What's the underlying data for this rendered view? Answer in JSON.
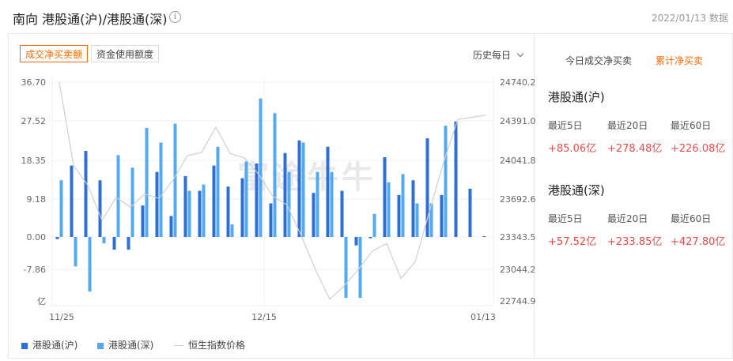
{
  "header": {
    "title": "南向 港股通(沪)/港股通(深)",
    "info_icon": "info-icon",
    "date": "2022/01/13 数据"
  },
  "tabs": {
    "net_buy": "成交净买卖额",
    "fund_usage": "资金使用额度"
  },
  "period_select": "历史每日",
  "watermark": "富途牛牛",
  "colors": {
    "hk_sh": "#2a6fdb",
    "hk_sz": "#55a9f0",
    "hsi": "#cfcfcf",
    "accent": "#ff6a00",
    "positive": "#f04848"
  },
  "chart_data": {
    "type": "bar",
    "left_axis_ticks": [
      "36.70",
      "27.52",
      "18.35",
      "9.18",
      "0.00",
      "-7.86",
      "亿"
    ],
    "right_axis_ticks": [
      "24740.2",
      "24391.0",
      "24041.8",
      "23692.6",
      "23343.5",
      "23044.2",
      "22744.9"
    ],
    "x_tick_labels": [
      "11/25",
      "12/15",
      "01/13"
    ],
    "ylim": [
      -14.5,
      36.7
    ],
    "y2lim": [
      22744.9,
      24740.2
    ],
    "n": 31,
    "series": [
      {
        "name": "港股通(沪)",
        "type": "bar",
        "values": [
          -0.5,
          17,
          20.5,
          13.5,
          -3,
          -3,
          7.5,
          15.5,
          5,
          14.5,
          11,
          17,
          12,
          14,
          17.5,
          8,
          20,
          23,
          10.5,
          21.5,
          11,
          -2,
          -0.3,
          19,
          10,
          13.5,
          23.5,
          10,
          27.5,
          11.5,
          0.2
        ]
      },
      {
        "name": "港股通(深)",
        "type": "bar",
        "values": [
          13.5,
          -7,
          -13,
          -1.5,
          19.5,
          16.5,
          26,
          22.5,
          27,
          11,
          12.5,
          21.5,
          3,
          18,
          33,
          29.5,
          15.5,
          22.5,
          15.5,
          15.5,
          -14.5,
          -14.5,
          5.5,
          13,
          15,
          8,
          8,
          26.5,
          0,
          0,
          0
        ]
      },
      {
        "name": "恒生指数价格",
        "type": "line",
        "values": [
          24740,
          23980,
          23800,
          23480,
          23690,
          23600,
          23720,
          23680,
          23850,
          24070,
          24100,
          24330,
          24090,
          24050,
          23900,
          23700,
          23620,
          23340,
          23030,
          22760,
          22880,
          23030,
          23200,
          23270,
          22950,
          23100,
          23560,
          24010,
          24400,
          24420,
          24440
        ]
      }
    ]
  },
  "legend": {
    "hk_sh": "港股通(沪)",
    "hk_sz": "港股通(深)",
    "hsi": "恒生指数价格"
  },
  "right_panel": {
    "tab_today": "今日成交净买卖",
    "tab_cumulative": "累计净买卖",
    "sections": [
      {
        "title": "港股通(沪)",
        "stats": [
          {
            "label": "最近5日",
            "value": "+85.06亿"
          },
          {
            "label": "最近20日",
            "value": "+278.48亿"
          },
          {
            "label": "最近60日",
            "value": "+226.08亿"
          }
        ]
      },
      {
        "title": "港股通(深)",
        "stats": [
          {
            "label": "最近5日",
            "value": "+57.52亿"
          },
          {
            "label": "最近20日",
            "value": "+233.85亿"
          },
          {
            "label": "最近60日",
            "value": "+427.80亿"
          }
        ]
      }
    ]
  }
}
